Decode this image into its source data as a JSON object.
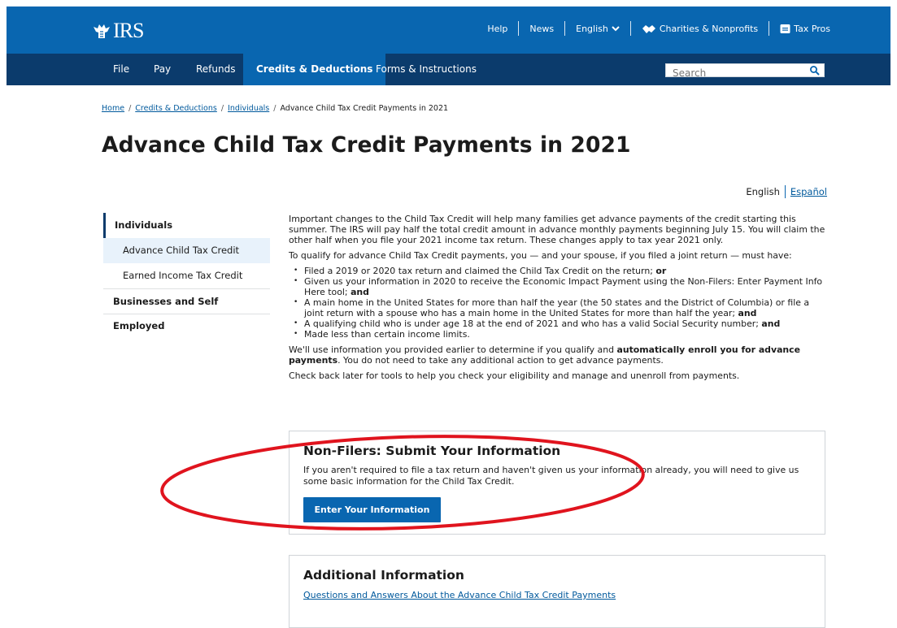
{
  "header": {
    "logo_text": "IRS",
    "utility": {
      "help": "Help",
      "news": "News",
      "language": "English",
      "charities": "Charities & Nonprofits",
      "tax_pros": "Tax Pros"
    },
    "nav": [
      "File",
      "Pay",
      "Refunds",
      "Credits & Deductions",
      "Forms & Instructions"
    ],
    "active_nav": "Credits & Deductions",
    "search_placeholder": "Search"
  },
  "breadcrumb": {
    "home": "Home",
    "credits": "Credits & Deductions",
    "individuals": "Individuals",
    "current": "Advance Child Tax Credit Payments in 2021"
  },
  "page_title": "Advance Child Tax Credit Payments in 2021",
  "language_toggle": {
    "current": "English",
    "alt": "Español"
  },
  "sidebar": {
    "top": "Individuals",
    "items": [
      "Advance Child Tax Credit",
      "Earned Income Tax Credit"
    ],
    "active_item": "Advance Child Tax Credit",
    "section2": "Businesses and Self Employed"
  },
  "main": {
    "intro": "Important changes to the Child Tax Credit will help many families get advance payments of the credit starting this summer. The IRS will pay half the total credit amount in advance monthly payments beginning July 15. You will claim the other half when you file your 2021 income tax return. These changes apply to tax year 2021 only.",
    "qualify_intro": "To qualify for advance Child Tax Credit payments, you — and your spouse, if you filed a joint return — must have:",
    "bullets": [
      {
        "text": "Filed a 2019 or 2020 tax return and claimed the Child Tax Credit on the return;",
        "bold": "or"
      },
      {
        "text": "Given us your information in 2020 to receive the Economic Impact Payment using the Non-Filers: Enter Payment Info Here tool;",
        "bold": "and"
      },
      {
        "text": "A main home in the United States for more than half the year (the 50 states and the District of Columbia) or file a joint return with a spouse who has a main home in the United States for more than half the year;",
        "bold": "and"
      },
      {
        "text": "A qualifying child who is under age 18 at the end of 2021 and who has a valid Social Security number;",
        "bold": "and"
      },
      {
        "text": "Made less than certain income limits.",
        "bold": ""
      }
    ],
    "enroll_prefix": "We'll use information you provided earlier to determine if you qualify and ",
    "enroll_bold": "automatically enroll you for advance payments",
    "enroll_suffix": ". You do not need to take any additional action to get advance payments.",
    "check_back": "Check back later for tools to help you check your eligibility and manage and unenroll from payments."
  },
  "nonfilers_card": {
    "title": "Non-Filers: Submit Your Information",
    "text": "If you aren't required to file a tax return and haven't given us your information already, you will need to give us some basic information for the Child Tax Credit.",
    "button": "Enter Your Information"
  },
  "additional_card": {
    "title": "Additional Information",
    "link": "Questions and Answers About the Advance Child Tax Credit Payments"
  },
  "colors": {
    "header_blue": "#0966b0",
    "nav_dark": "#0b3b6c",
    "link": "#00599c",
    "annotation_red": "#e0141e"
  }
}
